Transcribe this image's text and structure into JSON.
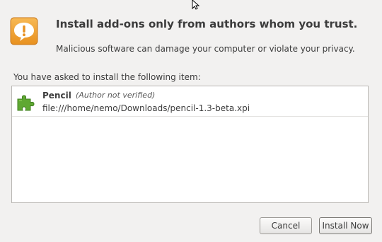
{
  "dialog": {
    "headline": "Install add-ons only from authors whom you trust.",
    "subline": "Malicious software can damage your computer or violate your privacy.",
    "list_label": "You have asked to install the following item:",
    "warning_icon": "speech-bubble-exclamation-icon",
    "items": [
      {
        "name": "Pencil",
        "verification": "(Author not verified)",
        "path": "file:///home/nemo/Downloads/pencil-1.3-beta.xpi",
        "icon": "puzzle-piece-icon"
      }
    ],
    "buttons": {
      "cancel": "Cancel",
      "install": "Install Now"
    }
  },
  "colors": {
    "background": "#f2f1f0",
    "warning_icon_fill": "#f0a030",
    "puzzle_icon_fill": "#5fa832",
    "list_background": "#ffffff"
  }
}
